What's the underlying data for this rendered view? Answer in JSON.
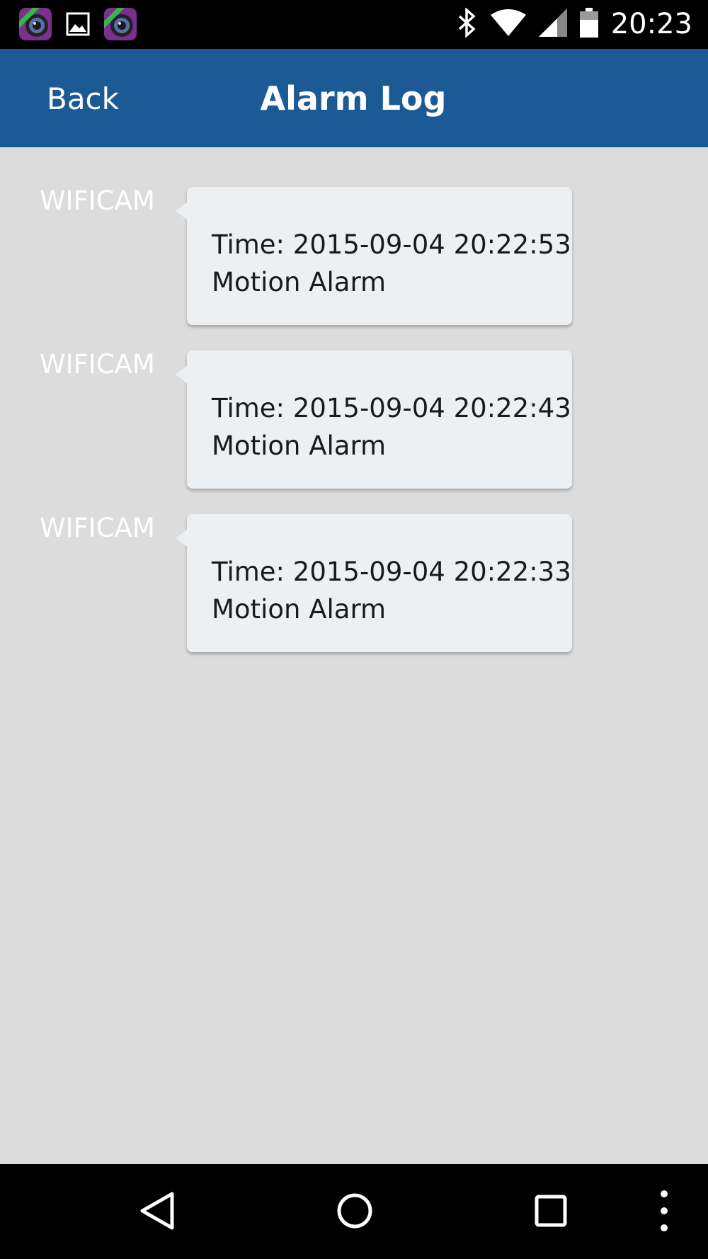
{
  "status_bar": {
    "time": "20:23",
    "notification_icons": [
      "ipcam-app-icon",
      "image-icon",
      "ipcam-app-icon"
    ],
    "system_icons": [
      "bluetooth-icon",
      "wifi-icon",
      "signal-icon",
      "battery-icon"
    ]
  },
  "app_bar": {
    "back_label": "Back",
    "title": "Alarm Log",
    "color": "#1c5a96"
  },
  "alarms": [
    {
      "sender": "WIFICAM",
      "time_label": "Time:",
      "time_value": "2015-09-04 20:22:53",
      "type": "Motion Alarm"
    },
    {
      "sender": "WIFICAM",
      "time_label": "Time:",
      "time_value": "2015-09-04 20:22:43",
      "type": "Motion Alarm"
    },
    {
      "sender": "WIFICAM",
      "time_label": "Time:",
      "time_value": "2015-09-04 20:22:33",
      "type": "Motion Alarm"
    }
  ],
  "nav_bar": {
    "buttons": [
      "back-triangle-icon",
      "home-circle-icon",
      "recents-square-icon",
      "overflow-menu-icon"
    ]
  }
}
